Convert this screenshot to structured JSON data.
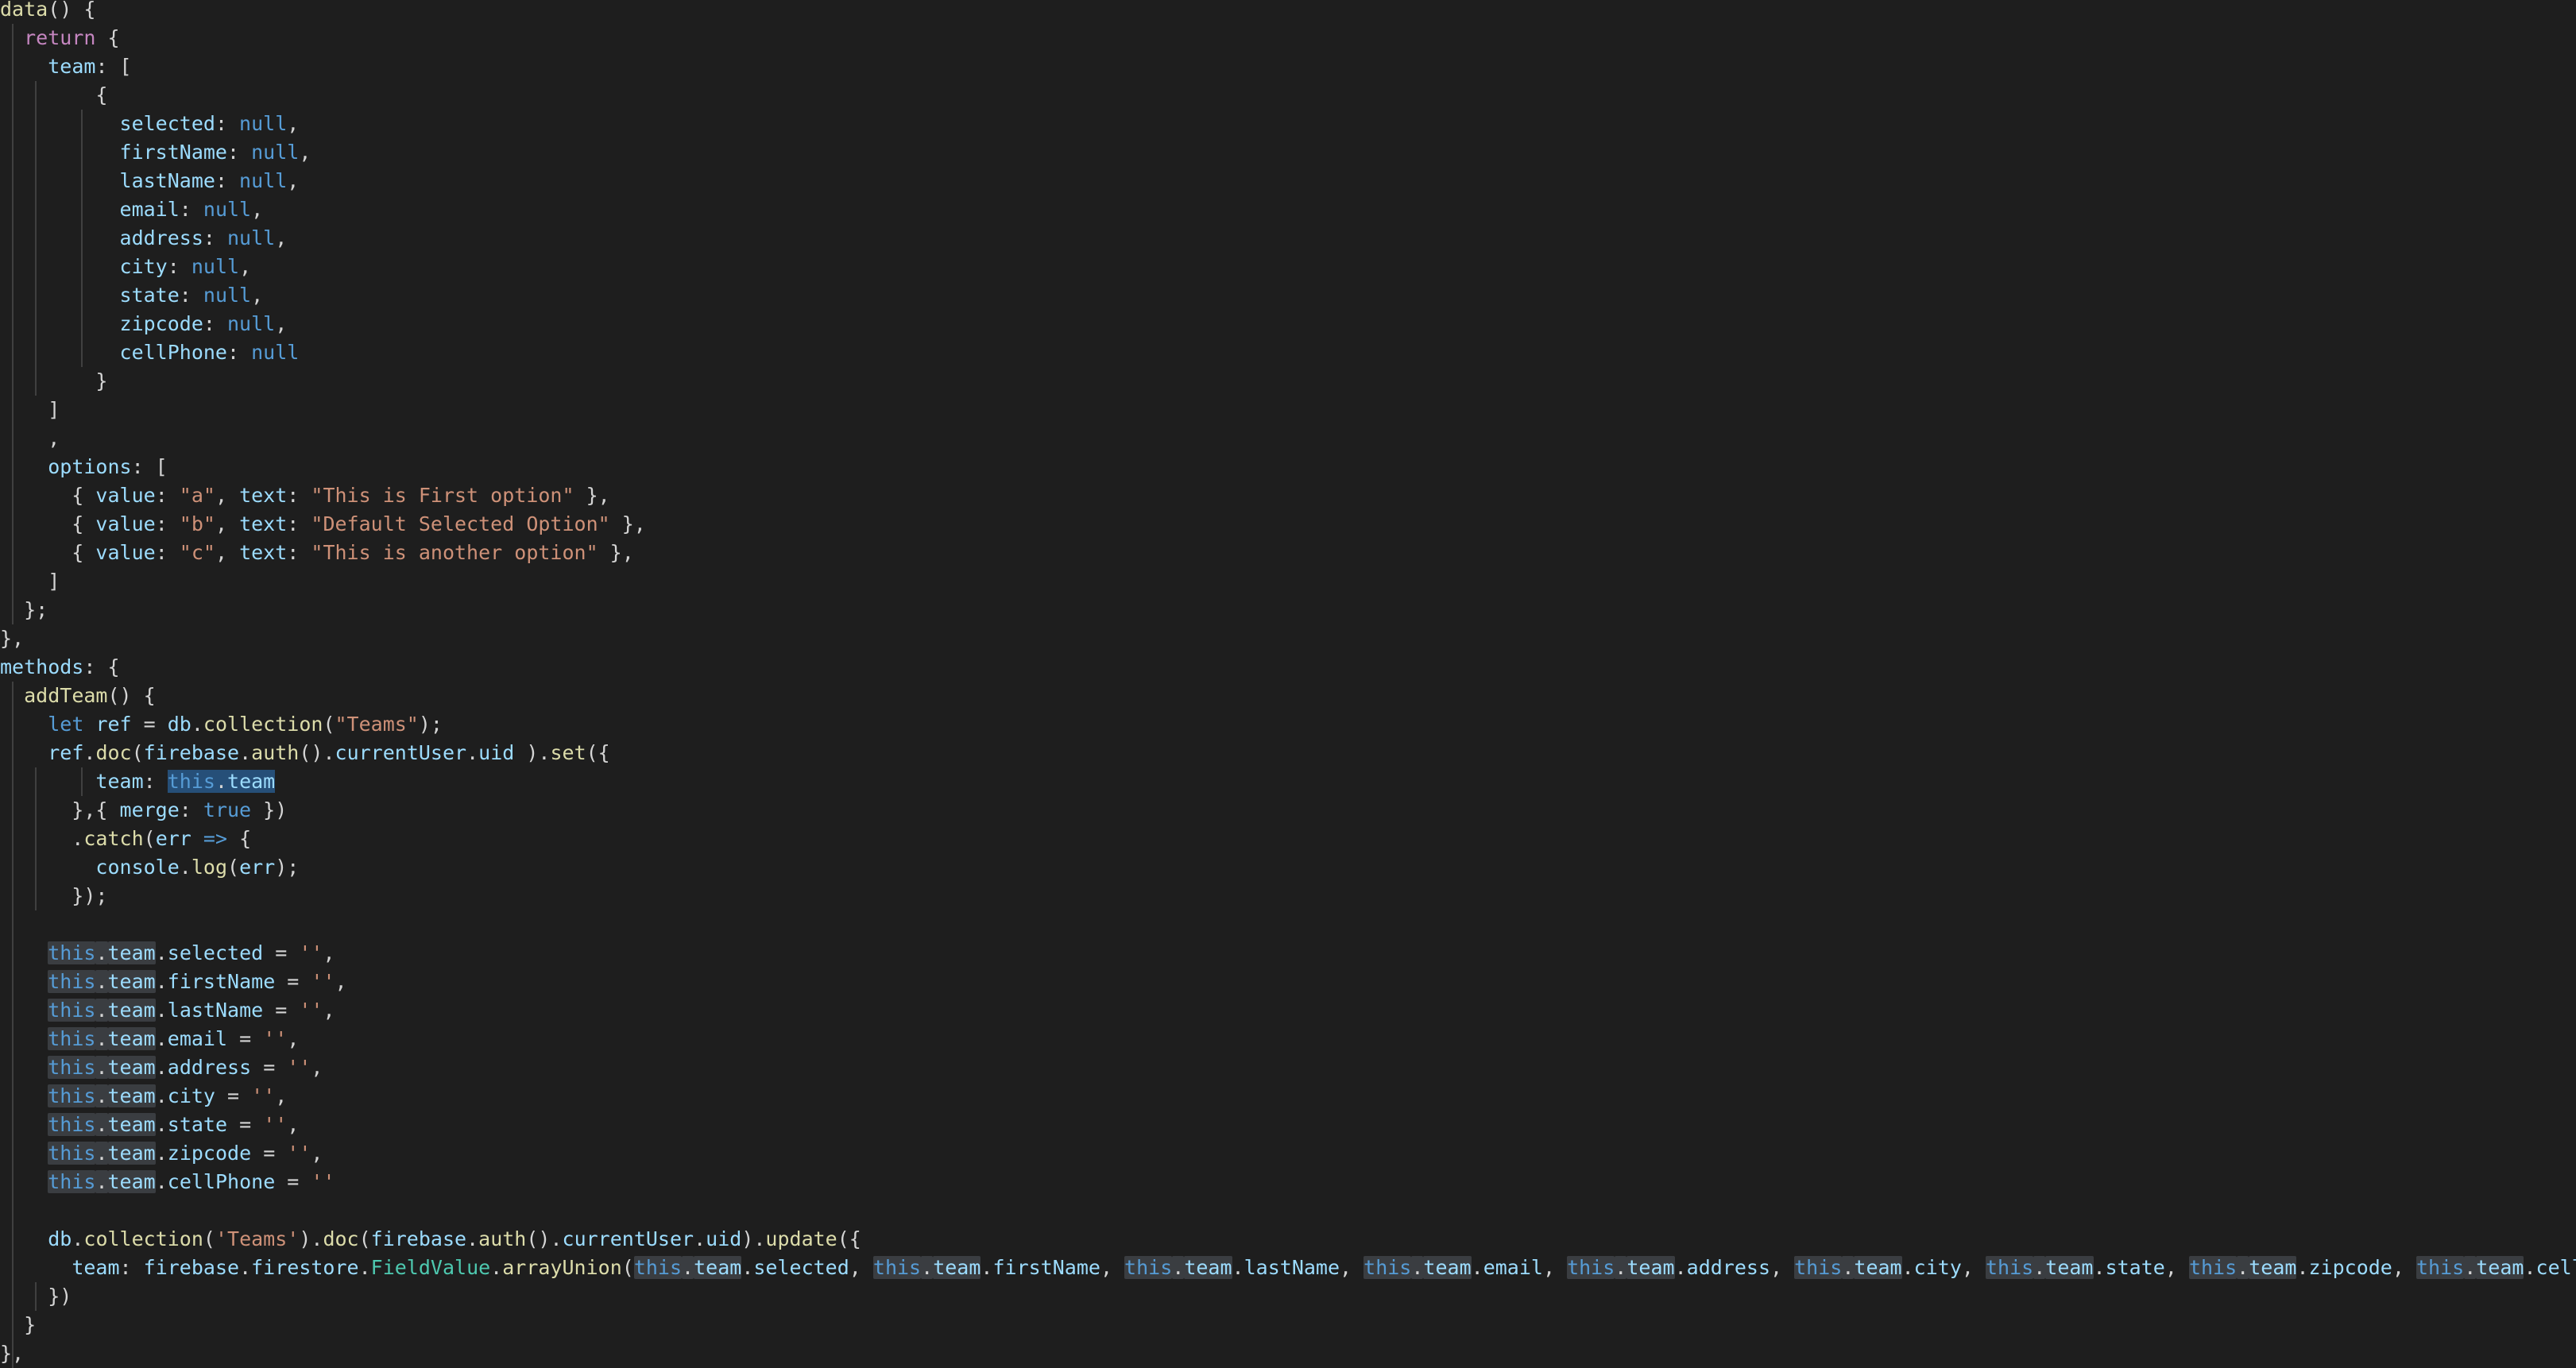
{
  "editor": {
    "language": "javascript",
    "theme_colors": {
      "background": "#1e1e1e",
      "keyword": "#c586c0",
      "literal": "#569cd6",
      "property": "#9cdcfe",
      "function": "#dcdcaa",
      "string": "#ce9178",
      "punctuation": "#d4d4d4",
      "highlight": "#3a3d41",
      "selection": "#264f78"
    },
    "lines": [
      [
        [
          "fn",
          "data"
        ],
        [
          "pun",
          "() {"
        ]
      ],
      [
        [
          "pun",
          "  "
        ],
        [
          "kw",
          "return"
        ],
        [
          "pun",
          " {"
        ]
      ],
      [
        [
          "pun",
          "    "
        ],
        [
          "prop",
          "team"
        ],
        [
          "pun",
          ": ["
        ]
      ],
      [
        [
          "pun",
          "        {"
        ]
      ],
      [
        [
          "pun",
          "          "
        ],
        [
          "prop",
          "selected"
        ],
        [
          "pun",
          ": "
        ],
        [
          "lit",
          "null"
        ],
        [
          "pun",
          ","
        ]
      ],
      [
        [
          "pun",
          "          "
        ],
        [
          "prop",
          "firstName"
        ],
        [
          "pun",
          ": "
        ],
        [
          "lit",
          "null"
        ],
        [
          "pun",
          ","
        ]
      ],
      [
        [
          "pun",
          "          "
        ],
        [
          "prop",
          "lastName"
        ],
        [
          "pun",
          ": "
        ],
        [
          "lit",
          "null"
        ],
        [
          "pun",
          ","
        ]
      ],
      [
        [
          "pun",
          "          "
        ],
        [
          "prop",
          "email"
        ],
        [
          "pun",
          ": "
        ],
        [
          "lit",
          "null"
        ],
        [
          "pun",
          ","
        ]
      ],
      [
        [
          "pun",
          "          "
        ],
        [
          "prop",
          "address"
        ],
        [
          "pun",
          ": "
        ],
        [
          "lit",
          "null"
        ],
        [
          "pun",
          ","
        ]
      ],
      [
        [
          "pun",
          "          "
        ],
        [
          "prop",
          "city"
        ],
        [
          "pun",
          ": "
        ],
        [
          "lit",
          "null"
        ],
        [
          "pun",
          ","
        ]
      ],
      [
        [
          "pun",
          "          "
        ],
        [
          "prop",
          "state"
        ],
        [
          "pun",
          ": "
        ],
        [
          "lit",
          "null"
        ],
        [
          "pun",
          ","
        ]
      ],
      [
        [
          "pun",
          "          "
        ],
        [
          "prop",
          "zipcode"
        ],
        [
          "pun",
          ": "
        ],
        [
          "lit",
          "null"
        ],
        [
          "pun",
          ","
        ]
      ],
      [
        [
          "pun",
          "          "
        ],
        [
          "prop",
          "cellPhone"
        ],
        [
          "pun",
          ": "
        ],
        [
          "lit",
          "null"
        ]
      ],
      [
        [
          "pun",
          "        }"
        ]
      ],
      [
        [
          "pun",
          "    ]"
        ]
      ],
      [
        [
          "pun",
          "    ,"
        ]
      ],
      [
        [
          "pun",
          "    "
        ],
        [
          "prop",
          "options"
        ],
        [
          "pun",
          ": ["
        ]
      ],
      [
        [
          "pun",
          "      { "
        ],
        [
          "prop",
          "value"
        ],
        [
          "pun",
          ": "
        ],
        [
          "str",
          "\"a\""
        ],
        [
          "pun",
          ", "
        ],
        [
          "prop",
          "text"
        ],
        [
          "pun",
          ": "
        ],
        [
          "str",
          "\"This is First option\""
        ],
        [
          "pun",
          " },"
        ]
      ],
      [
        [
          "pun",
          "      { "
        ],
        [
          "prop",
          "value"
        ],
        [
          "pun",
          ": "
        ],
        [
          "str",
          "\"b\""
        ],
        [
          "pun",
          ", "
        ],
        [
          "prop",
          "text"
        ],
        [
          "pun",
          ": "
        ],
        [
          "str",
          "\"Default Selected Option\""
        ],
        [
          "pun",
          " },"
        ]
      ],
      [
        [
          "pun",
          "      { "
        ],
        [
          "prop",
          "value"
        ],
        [
          "pun",
          ": "
        ],
        [
          "str",
          "\"c\""
        ],
        [
          "pun",
          ", "
        ],
        [
          "prop",
          "text"
        ],
        [
          "pun",
          ": "
        ],
        [
          "str",
          "\"This is another option\""
        ],
        [
          "pun",
          " },"
        ]
      ],
      [
        [
          "pun",
          "    ]"
        ]
      ],
      [
        [
          "pun",
          "  };"
        ]
      ],
      [
        [
          "pun",
          "},"
        ]
      ],
      [
        [
          "prop",
          "methods"
        ],
        [
          "pun",
          ": {"
        ]
      ],
      [
        [
          "pun",
          "  "
        ],
        [
          "fn",
          "addTeam"
        ],
        [
          "pun",
          "() {"
        ]
      ],
      [
        [
          "pun",
          "    "
        ],
        [
          "decl",
          "let"
        ],
        [
          "pun",
          " "
        ],
        [
          "var",
          "ref"
        ],
        [
          "pun",
          " = "
        ],
        [
          "var",
          "db"
        ],
        [
          "pun",
          "."
        ],
        [
          "fn",
          "collection"
        ],
        [
          "pun",
          "("
        ],
        [
          "str",
          "\"Teams\""
        ],
        [
          "pun",
          ");"
        ]
      ],
      [
        [
          "pun",
          "    "
        ],
        [
          "var",
          "ref"
        ],
        [
          "pun",
          "."
        ],
        [
          "fn",
          "doc"
        ],
        [
          "pun",
          "("
        ],
        [
          "var",
          "firebase"
        ],
        [
          "pun",
          "."
        ],
        [
          "fn",
          "auth"
        ],
        [
          "pun",
          "()."
        ],
        [
          "var",
          "currentUser"
        ],
        [
          "pun",
          "."
        ],
        [
          "var",
          "uid"
        ],
        [
          "pun",
          " )."
        ],
        [
          "fn",
          "set"
        ],
        [
          "pun",
          "({"
        ]
      ],
      [
        [
          "pun",
          "        "
        ],
        [
          "prop",
          "team"
        ],
        [
          "pun",
          ": "
        ],
        [
          "thisSel",
          "this"
        ],
        [
          "sel",
          "."
        ],
        [
          "propSel",
          "team"
        ]
      ],
      [
        [
          "pun",
          "      },{ "
        ],
        [
          "prop",
          "merge"
        ],
        [
          "pun",
          ": "
        ],
        [
          "lit",
          "true"
        ],
        [
          "pun",
          " })"
        ]
      ],
      [
        [
          "pun",
          "      ."
        ],
        [
          "fn",
          "catch"
        ],
        [
          "pun",
          "("
        ],
        [
          "var",
          "err"
        ],
        [
          "pun",
          " "
        ],
        [
          "decl",
          "=>"
        ],
        [
          "pun",
          " {"
        ]
      ],
      [
        [
          "pun",
          "        "
        ],
        [
          "var",
          "console"
        ],
        [
          "pun",
          "."
        ],
        [
          "fn",
          "log"
        ],
        [
          "pun",
          "("
        ],
        [
          "var",
          "err"
        ],
        [
          "pun",
          ");"
        ]
      ],
      [
        [
          "pun",
          "      });"
        ]
      ],
      [],
      [
        [
          "pun",
          "    "
        ],
        [
          "thisHl",
          "this"
        ],
        [
          "hlp",
          "."
        ],
        [
          "propHl",
          "team"
        ],
        [
          "pun",
          "."
        ],
        [
          "prop",
          "selected"
        ],
        [
          "pun",
          " = "
        ],
        [
          "str",
          "''"
        ],
        [
          "pun",
          ","
        ]
      ],
      [
        [
          "pun",
          "    "
        ],
        [
          "thisHl",
          "this"
        ],
        [
          "hlp",
          "."
        ],
        [
          "propHl",
          "team"
        ],
        [
          "pun",
          "."
        ],
        [
          "prop",
          "firstName"
        ],
        [
          "pun",
          " = "
        ],
        [
          "str",
          "''"
        ],
        [
          "pun",
          ","
        ]
      ],
      [
        [
          "pun",
          "    "
        ],
        [
          "thisHl",
          "this"
        ],
        [
          "hlp",
          "."
        ],
        [
          "propHl",
          "team"
        ],
        [
          "pun",
          "."
        ],
        [
          "prop",
          "lastName"
        ],
        [
          "pun",
          " = "
        ],
        [
          "str",
          "''"
        ],
        [
          "pun",
          ","
        ]
      ],
      [
        [
          "pun",
          "    "
        ],
        [
          "thisHl",
          "this"
        ],
        [
          "hlp",
          "."
        ],
        [
          "propHl",
          "team"
        ],
        [
          "pun",
          "."
        ],
        [
          "prop",
          "email"
        ],
        [
          "pun",
          " = "
        ],
        [
          "str",
          "''"
        ],
        [
          "pun",
          ","
        ]
      ],
      [
        [
          "pun",
          "    "
        ],
        [
          "thisHl",
          "this"
        ],
        [
          "hlp",
          "."
        ],
        [
          "propHl",
          "team"
        ],
        [
          "pun",
          "."
        ],
        [
          "prop",
          "address"
        ],
        [
          "pun",
          " = "
        ],
        [
          "str",
          "''"
        ],
        [
          "pun",
          ","
        ]
      ],
      [
        [
          "pun",
          "    "
        ],
        [
          "thisHl",
          "this"
        ],
        [
          "hlp",
          "."
        ],
        [
          "propHl",
          "team"
        ],
        [
          "pun",
          "."
        ],
        [
          "prop",
          "city"
        ],
        [
          "pun",
          " = "
        ],
        [
          "str",
          "''"
        ],
        [
          "pun",
          ","
        ]
      ],
      [
        [
          "pun",
          "    "
        ],
        [
          "thisHl",
          "this"
        ],
        [
          "hlp",
          "."
        ],
        [
          "propHl",
          "team"
        ],
        [
          "pun",
          "."
        ],
        [
          "prop",
          "state"
        ],
        [
          "pun",
          " = "
        ],
        [
          "str",
          "''"
        ],
        [
          "pun",
          ","
        ]
      ],
      [
        [
          "pun",
          "    "
        ],
        [
          "thisHl",
          "this"
        ],
        [
          "hlp",
          "."
        ],
        [
          "propHl",
          "team"
        ],
        [
          "pun",
          "."
        ],
        [
          "prop",
          "zipcode"
        ],
        [
          "pun",
          " = "
        ],
        [
          "str",
          "''"
        ],
        [
          "pun",
          ","
        ]
      ],
      [
        [
          "pun",
          "    "
        ],
        [
          "thisHl",
          "this"
        ],
        [
          "hlp",
          "."
        ],
        [
          "propHl",
          "team"
        ],
        [
          "pun",
          "."
        ],
        [
          "prop",
          "cellPhone"
        ],
        [
          "pun",
          " = "
        ],
        [
          "str",
          "''"
        ]
      ],
      [],
      [
        [
          "pun",
          "    "
        ],
        [
          "var",
          "db"
        ],
        [
          "pun",
          "."
        ],
        [
          "fn",
          "collection"
        ],
        [
          "pun",
          "("
        ],
        [
          "str",
          "'Teams'"
        ],
        [
          "pun",
          ")."
        ],
        [
          "fn",
          "doc"
        ],
        [
          "pun",
          "("
        ],
        [
          "var",
          "firebase"
        ],
        [
          "pun",
          "."
        ],
        [
          "fn",
          "auth"
        ],
        [
          "pun",
          "()."
        ],
        [
          "var",
          "currentUser"
        ],
        [
          "pun",
          "."
        ],
        [
          "var",
          "uid"
        ],
        [
          "pun",
          ")."
        ],
        [
          "fn",
          "update"
        ],
        [
          "pun",
          "({"
        ]
      ],
      [
        [
          "pun",
          "      "
        ],
        [
          "prop",
          "team"
        ],
        [
          "pun",
          ": "
        ],
        [
          "var",
          "firebase"
        ],
        [
          "pun",
          "."
        ],
        [
          "var",
          "firestore"
        ],
        [
          "pun",
          "."
        ],
        [
          "cls",
          "FieldValue"
        ],
        [
          "pun",
          "."
        ],
        [
          "fn",
          "arrayUnion"
        ],
        [
          "pun",
          "("
        ],
        [
          "thisHl",
          "this"
        ],
        [
          "hlp",
          "."
        ],
        [
          "propHl",
          "team"
        ],
        [
          "pun",
          "."
        ],
        [
          "prop",
          "selected"
        ],
        [
          "pun",
          ", "
        ],
        [
          "thisHl",
          "this"
        ],
        [
          "hlp",
          "."
        ],
        [
          "propHl",
          "team"
        ],
        [
          "pun",
          "."
        ],
        [
          "prop",
          "firstName"
        ],
        [
          "pun",
          ", "
        ],
        [
          "thisHl",
          "this"
        ],
        [
          "hlp",
          "."
        ],
        [
          "propHl",
          "team"
        ],
        [
          "pun",
          "."
        ],
        [
          "prop",
          "lastName"
        ],
        [
          "pun",
          ", "
        ],
        [
          "thisHl",
          "this"
        ],
        [
          "hlp",
          "."
        ],
        [
          "propHl",
          "team"
        ],
        [
          "pun",
          "."
        ],
        [
          "prop",
          "email"
        ],
        [
          "pun",
          ", "
        ],
        [
          "thisHl",
          "this"
        ],
        [
          "hlp",
          "."
        ],
        [
          "propHl",
          "team"
        ],
        [
          "pun",
          "."
        ],
        [
          "prop",
          "address"
        ],
        [
          "pun",
          ", "
        ],
        [
          "thisHl",
          "this"
        ],
        [
          "hlp",
          "."
        ],
        [
          "propHl",
          "team"
        ],
        [
          "pun",
          "."
        ],
        [
          "prop",
          "city"
        ],
        [
          "pun",
          ", "
        ],
        [
          "thisHl",
          "this"
        ],
        [
          "hlp",
          "."
        ],
        [
          "propHl",
          "team"
        ],
        [
          "pun",
          "."
        ],
        [
          "prop",
          "state"
        ],
        [
          "pun",
          ", "
        ],
        [
          "thisHl",
          "this"
        ],
        [
          "hlp",
          "."
        ],
        [
          "propHl",
          "team"
        ],
        [
          "pun",
          "."
        ],
        [
          "prop",
          "zipcode"
        ],
        [
          "pun",
          ", "
        ],
        [
          "thisHl",
          "this"
        ],
        [
          "hlp",
          "."
        ],
        [
          "propHl",
          "team"
        ],
        [
          "pun",
          "."
        ],
        [
          "prop",
          "cellPhone"
        ],
        [
          "pun",
          ")"
        ]
      ],
      [
        [
          "pun",
          "    })"
        ]
      ],
      [
        [
          "pun",
          "  }"
        ]
      ],
      [
        [
          "pun",
          "},"
        ]
      ]
    ]
  }
}
